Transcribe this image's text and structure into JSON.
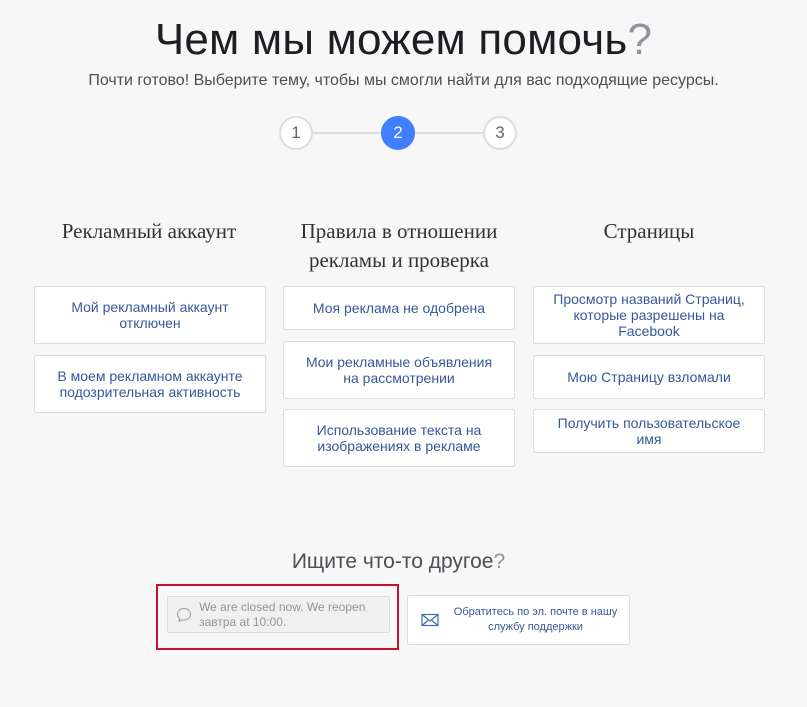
{
  "header": {
    "title": "Чем мы можем помочь",
    "title_mark": "?",
    "subtitle": "Почти готово! Выберите тему, чтобы мы смогли найти для вас подходящие ресурсы."
  },
  "stepper": {
    "steps": [
      "1",
      "2",
      "3"
    ],
    "active_step": 2,
    "active_color": "#4080ff"
  },
  "columns": [
    {
      "heading": "Рекламный аккаунт",
      "items": [
        "Мой рекламный аккаунт отключен",
        "В моем рекламном аккаунте подозрительная активность"
      ]
    },
    {
      "heading": "Правила в отношении рекламы и проверка",
      "items": [
        "Моя реклама не одобрена",
        "Мои рекламные объявления на рассмотрении",
        "Использование текста на изображениях в рекламе"
      ]
    },
    {
      "heading": "Страницы",
      "items": [
        "Просмотр названий Страниц, которые разрешены на Facebook",
        "Мою Страницу взломали",
        "Получить пользовательское имя"
      ]
    }
  ],
  "other": {
    "title": "Ищите что-то другое",
    "title_mark": "?",
    "chat": {
      "icon": "chat-bubble-icon",
      "text": "We are closed now. We reopen завтра at 10:00."
    },
    "email": {
      "icon": "envelope-icon",
      "text": "Обратитесь по эл. почте в нашу службу поддержки"
    },
    "highlight_color": "#c8102e"
  }
}
